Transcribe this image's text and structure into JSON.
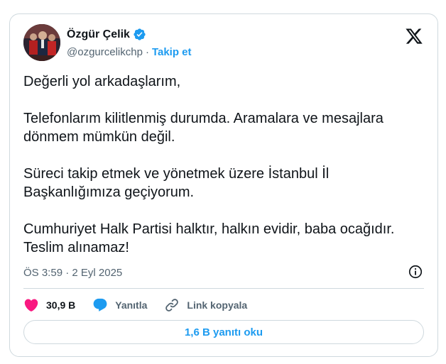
{
  "author": {
    "name": "Özgür Çelik",
    "handle": "@ozgurcelikchp",
    "separator": "·",
    "follow_label": "Takip et"
  },
  "tweet": {
    "paragraphs": [
      "Değerli yol arkadaşlarım,",
      "Telefonlarım kilitlenmiş durumda. Aramalara ve mesajlara\ndönmem mümkün değil.",
      "Süreci takip etmek ve yönetmek üzere İstanbul İl\nBaşkanlığımıza geçiyorum.",
      "Cumhuriyet Halk Partisi halktır, halkın evidir, baba ocağıdır.\nTeslim alınamaz!"
    ],
    "timestamp": "ÖS 3:59 · 2 Eyl 2025"
  },
  "actions": {
    "likes": "30,9 B",
    "reply_label": "Yanıtla",
    "copy_link_label": "Link kopyala"
  },
  "replies_button": "1,6 B yanıtı oku",
  "colors": {
    "accent": "#1d9bf0",
    "like": "#f91880",
    "text": "#0f1419",
    "muted": "#536471",
    "border": "#cfd9de"
  },
  "icons": [
    "verified-badge-icon",
    "x-logo-icon",
    "info-icon",
    "heart-icon",
    "reply-bubble-icon",
    "link-icon"
  ]
}
